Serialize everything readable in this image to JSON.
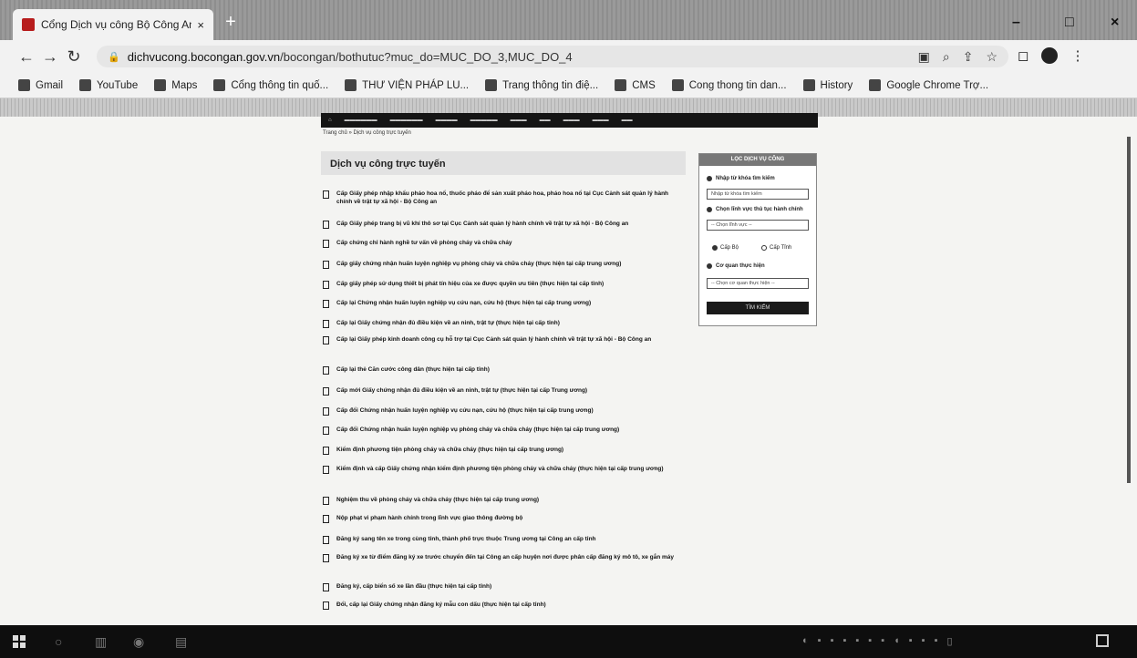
{
  "browser": {
    "tab_title": "Cổng Dịch vụ công Bộ Công An",
    "tab_close": "×",
    "new_tab": "+",
    "address_host": "dichvucong.bocongan.gov.vn",
    "address_path": "/bocongan/bothutuc?muc_do=MUC_DO_3,MUC_DO_4",
    "window_controls": [
      "–",
      "□",
      "×"
    ],
    "bookmarks": [
      {
        "label": "Gmail",
        "icon": "gmail-icon"
      },
      {
        "label": "YouTube",
        "icon": "youtube-icon"
      },
      {
        "label": "Maps",
        "icon": "maps-icon"
      },
      {
        "label": "Cổng thông tin quố...",
        "icon": "portal-icon"
      },
      {
        "label": "THƯ VIỆN PHÁP LU...",
        "icon": "library-icon"
      },
      {
        "label": "Trang thông tin điệ...",
        "icon": "globe-icon"
      },
      {
        "label": "CMS",
        "icon": "cms-icon"
      },
      {
        "label": "Cong thong tin dan...",
        "icon": "portal-icon"
      },
      {
        "label": "History",
        "icon": "history-icon"
      },
      {
        "label": "Google Chrome Trợ...",
        "icon": "google-icon"
      }
    ]
  },
  "page": {
    "breadcrumb": "Trang chủ » Dịch vụ công trực tuyến",
    "section_title": "Dịch vụ công trực tuyến",
    "services": [
      "Cấp Giấy phép nhập khẩu pháo hoa nổ, thuốc pháo để sản xuất pháo hoa, pháo hoa nổ tại Cục Cảnh sát quản lý hành chính về trật tự xã hội - Bộ Công an",
      "Cấp Giấy phép trang bị vũ khí thô sơ tại Cục Cảnh sát quản lý hành chính về trật tự xã hội - Bộ Công an",
      "Cấp chứng chỉ hành nghề tư vấn về phòng cháy và chữa cháy",
      "Cấp giấy chứng nhận huấn luyện nghiệp vụ phòng cháy và chữa cháy (thực hiện tại cấp trung ương)",
      "Cấp giấy phép sử dụng thiết bị phát tín hiệu của xe được quyền ưu tiên (thực hiện tại cấp tỉnh)",
      "Cấp lại Chứng nhận huấn luyện nghiệp vụ cứu nạn, cứu hộ (thực hiện tại cấp trung ương)",
      "Cấp lại Giấy chứng nhận đủ điều kiện về an ninh, trật tự (thực hiện tại cấp tỉnh)",
      "Cấp lại Giấy phép kinh doanh công cụ hỗ trợ tại Cục Cảnh sát quản lý hành chính về trật tự xã hội - Bộ Công an",
      "Cấp lại thẻ Căn cước công dân (thực hiện tại cấp tỉnh)",
      "Cấp mới Giấy chứng nhận đủ điều kiện về an ninh, trật tự (thực hiện tại cấp Trung ương)",
      "Cấp đổi Chứng nhận huấn luyện nghiệp vụ cứu nạn, cứu hộ (thực hiện tại cấp trung ương)",
      "Cấp đổi Chứng nhận huấn luyện nghiệp vụ phòng cháy và chữa cháy (thực hiện tại cấp trung ương)",
      "Kiểm định phương tiện phòng cháy và chữa cháy (thực hiện tại cấp trung ương)",
      "Kiểm định và cấp Giấy chứng nhận kiểm định phương tiện phòng cháy và chữa cháy (thực hiện tại cấp trung ương)",
      "Nghiệm thu về phòng cháy và chữa cháy (thực hiện tại cấp trung ương)",
      "Nộp phạt vi phạm hành chính trong lĩnh vực giao thông đường bộ",
      "Đăng ký sang tên xe trong cùng tỉnh, thành phố trực thuộc Trung ương tại Công an cấp tỉnh",
      "Đăng ký xe từ điểm đăng ký xe trước chuyển đến tại Công an cấp huyện nơi được phân cấp đăng ký mô tô, xe gắn máy",
      "Đăng ký, cấp biển số xe lần đầu (thực hiện tại cấp tỉnh)",
      "Đổi, cấp lại Giấy chứng nhận đăng ký mẫu con dấu (thực hiện tại cấp tỉnh)"
    ]
  },
  "filter": {
    "header": "LỌC DỊCH VỤ CÔNG",
    "keyword_label": "Nhập từ khóa tìm kiếm",
    "keyword_placeholder": "Nhập từ khóa tìm kiếm",
    "agency_label": "Chọn lĩnh vực thủ tục hành chính",
    "agency_value": "-- Chọn lĩnh vực --",
    "radio_1": "Cấp Bộ",
    "radio_2": "Cấp Tỉnh",
    "level_label": "Cơ quan thực hiện",
    "level_value": "-- Chọn cơ quan thực hiện --",
    "submit": "TÌM KIẾM"
  }
}
